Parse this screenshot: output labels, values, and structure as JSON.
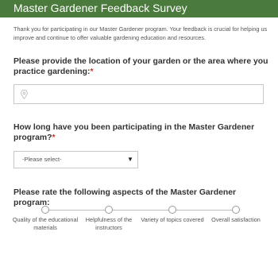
{
  "header": {
    "title": "Master Gardener Feedback Survey"
  },
  "intro": "Thank you for participating in our Master Gardener program. Your feedback is crucial for helping us improve and continue to offer valuable gardening education and resources.",
  "questions": {
    "location": {
      "label": "Please provide the location of your garden or the area where you practice gardening:",
      "required_mark": "*",
      "value": ""
    },
    "duration": {
      "label": "How long have you been participating in the Master Gardener program?",
      "required_mark": "*",
      "selected": "-Please select-",
      "caret": "▼"
    },
    "rating": {
      "label": "Please rate the following aspects of the Master Gardener program:",
      "aspects": [
        "Quality of the educational materials",
        "Helpfulness of the instructors",
        "Variety of topics covered",
        "Overall satisfaction"
      ]
    }
  },
  "colors": {
    "header_bg": "#4a7a3c",
    "required": "#c0392b",
    "border": "#c8c8c8"
  },
  "icons": {
    "location": "map-pin-icon"
  }
}
